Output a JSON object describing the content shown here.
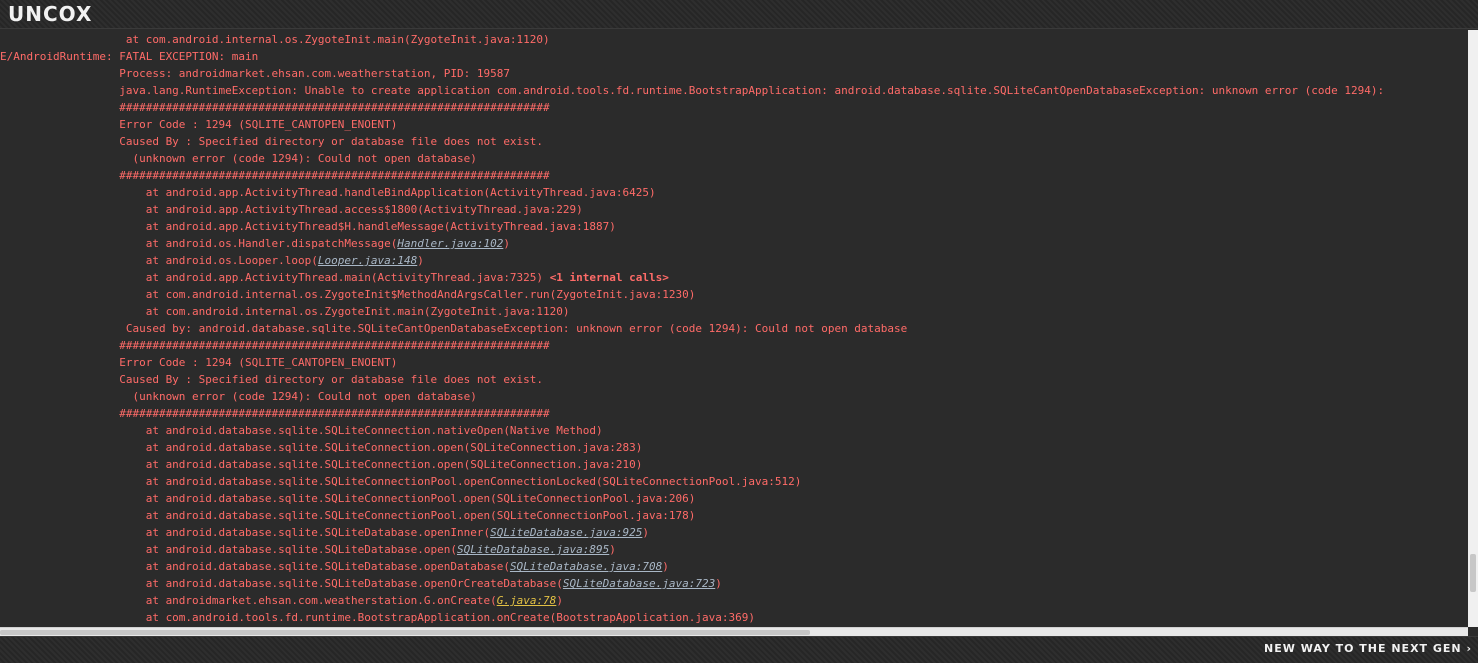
{
  "header": {
    "logo": "UNCOX"
  },
  "footer": {
    "tagline": "NEW WAY TO THE NEXT GEN ›"
  },
  "colors": {
    "error_text": "#ff6b68",
    "link_text": "#a9b7c6",
    "highlight_link": "#e2c044",
    "background": "#2b2b2b"
  },
  "log": {
    "lines": [
      {
        "prefix": "                   at com.android.internal.os.ZygoteInit.main(ZygoteInit.java:1120)",
        "link": "",
        "suffix": ""
      },
      {
        "prefix": "E/AndroidRuntime: FATAL EXCEPTION: main",
        "link": "",
        "suffix": ""
      },
      {
        "prefix": "                  Process: androidmarket.ehsan.com.weatherstation, PID: 19587",
        "link": "",
        "suffix": ""
      },
      {
        "prefix": "                  java.lang.RuntimeException: Unable to create application com.android.tools.fd.runtime.BootstrapApplication: android.database.sqlite.SQLiteCantOpenDatabaseException: unknown error (code 1294):",
        "link": "",
        "suffix": ""
      },
      {
        "prefix": "                  #################################################################",
        "link": "",
        "suffix": ""
      },
      {
        "prefix": "                  Error Code : 1294 (SQLITE_CANTOPEN_ENOENT)",
        "link": "",
        "suffix": ""
      },
      {
        "prefix": "                  Caused By : Specified directory or database file does not exist.",
        "link": "",
        "suffix": ""
      },
      {
        "prefix": "                    (unknown error (code 1294): Could not open database)",
        "link": "",
        "suffix": ""
      },
      {
        "prefix": "                  #################################################################",
        "link": "",
        "suffix": ""
      },
      {
        "prefix": "                      at android.app.ActivityThread.handleBindApplication(ActivityThread.java:6425)",
        "link": "",
        "suffix": ""
      },
      {
        "prefix": "                      at android.app.ActivityThread.access$1800(ActivityThread.java:229)",
        "link": "",
        "suffix": ""
      },
      {
        "prefix": "                      at android.app.ActivityThread$H.handleMessage(ActivityThread.java:1887)",
        "link": "",
        "suffix": ""
      },
      {
        "prefix": "                      at android.os.Handler.dispatchMessage(",
        "link": "Handler.java:102",
        "suffix": ")"
      },
      {
        "prefix": "                      at android.os.Looper.loop(",
        "link": "Looper.java:148",
        "suffix": ")"
      },
      {
        "prefix": "                      at android.app.ActivityThread.main(ActivityThread.java:7325) ",
        "link": "",
        "suffix": "",
        "bold": "<1 internal calls>"
      },
      {
        "prefix": "                      at com.android.internal.os.ZygoteInit$MethodAndArgsCaller.run(ZygoteInit.java:1230)",
        "link": "",
        "suffix": ""
      },
      {
        "prefix": "                      at com.android.internal.os.ZygoteInit.main(ZygoteInit.java:1120)",
        "link": "",
        "suffix": ""
      },
      {
        "prefix": "                   Caused by: android.database.sqlite.SQLiteCantOpenDatabaseException: unknown error (code 1294): Could not open database",
        "link": "",
        "suffix": ""
      },
      {
        "prefix": "                  #################################################################",
        "link": "",
        "suffix": ""
      },
      {
        "prefix": "                  Error Code : 1294 (SQLITE_CANTOPEN_ENOENT)",
        "link": "",
        "suffix": ""
      },
      {
        "prefix": "                  Caused By : Specified directory or database file does not exist.",
        "link": "",
        "suffix": ""
      },
      {
        "prefix": "                    (unknown error (code 1294): Could not open database)",
        "link": "",
        "suffix": ""
      },
      {
        "prefix": "                  #################################################################",
        "link": "",
        "suffix": ""
      },
      {
        "prefix": "                      at android.database.sqlite.SQLiteConnection.nativeOpen(Native Method)",
        "link": "",
        "suffix": ""
      },
      {
        "prefix": "                      at android.database.sqlite.SQLiteConnection.open(SQLiteConnection.java:283)",
        "link": "",
        "suffix": ""
      },
      {
        "prefix": "                      at android.database.sqlite.SQLiteConnection.open(SQLiteConnection.java:210)",
        "link": "",
        "suffix": ""
      },
      {
        "prefix": "                      at android.database.sqlite.SQLiteConnectionPool.openConnectionLocked(SQLiteConnectionPool.java:512)",
        "link": "",
        "suffix": ""
      },
      {
        "prefix": "                      at android.database.sqlite.SQLiteConnectionPool.open(SQLiteConnectionPool.java:206)",
        "link": "",
        "suffix": ""
      },
      {
        "prefix": "                      at android.database.sqlite.SQLiteConnectionPool.open(SQLiteConnectionPool.java:178)",
        "link": "",
        "suffix": ""
      },
      {
        "prefix": "                      at android.database.sqlite.SQLiteDatabase.openInner(",
        "link": "SQLiteDatabase.java:925",
        "suffix": ")"
      },
      {
        "prefix": "                      at android.database.sqlite.SQLiteDatabase.open(",
        "link": "SQLiteDatabase.java:895",
        "suffix": ")"
      },
      {
        "prefix": "                      at android.database.sqlite.SQLiteDatabase.openDatabase(",
        "link": "SQLiteDatabase.java:708",
        "suffix": ")"
      },
      {
        "prefix": "                      at android.database.sqlite.SQLiteDatabase.openOrCreateDatabase(",
        "link": "SQLiteDatabase.java:723",
        "suffix": ")"
      },
      {
        "prefix": "                      at androidmarket.ehsan.com.weatherstation.G.onCreate(",
        "link": "G.java:78",
        "suffix": ")",
        "yellow": true
      },
      {
        "prefix": "                      at com.android.tools.fd.runtime.BootstrapApplication.onCreate(BootstrapApplication.java:369)",
        "link": "",
        "suffix": ""
      }
    ]
  }
}
